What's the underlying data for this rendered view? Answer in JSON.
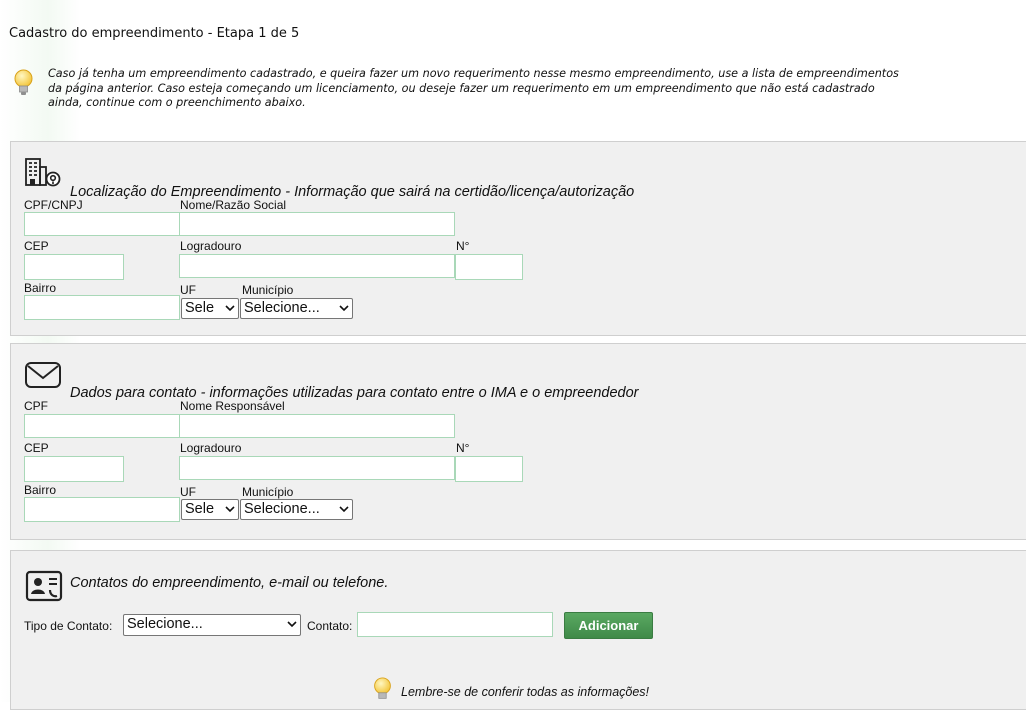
{
  "page_title": "Cadastro do empreendimento - Etapa 1 de 5",
  "notice": {
    "lines": [
      "Caso já tenha um empreendimento cadastrado, e queira fazer um novo requerimento nesse mesmo empreendimento, use a lista de empreendimentos",
      "da página anterior. Caso esteja começando um licenciamento, ou deseje fazer um requerimento em um empreendimento que não está cadastrado",
      "ainda, continue com o preenchimento abaixo."
    ]
  },
  "location": {
    "title": "Localização do Empreendimento - Informação que sairá na certidão/licença/autorização",
    "cpf_cnpj_label": "CPF/CNPJ",
    "name_label": "Nome/Razão Social",
    "cep_label": "CEP",
    "street_label": "Logradouro",
    "number_label": "N°",
    "district_label": "Bairro",
    "uf_label": "UF",
    "city_label": "Município",
    "uf_value": "Sele",
    "city_value": "Selecione..."
  },
  "contact": {
    "title": "Dados para contato - informações utilizadas para contato entre o IMA e o empreendedor",
    "cpf_label": "CPF",
    "name_label": "Nome Responsável",
    "cep_label": "CEP",
    "street_label": "Logradouro",
    "number_label": "N°",
    "district_label": "Bairro",
    "uf_label": "UF",
    "city_label": "Município",
    "uf_value": "Sele",
    "city_value": "Selecione..."
  },
  "contacts": {
    "title": "Contatos do empreendimento, e-mail ou telefone.",
    "type_label": "Tipo de Contato:",
    "type_value": "Selecione...",
    "contact_label": "Contato:",
    "add_button": "Adicionar"
  },
  "reminder": "Lembre-se de conferir todas as informações!",
  "icons": {
    "notice": "lightbulb-icon",
    "location": "building-location-icon",
    "contact": "envelope-icon",
    "contacts": "contact-card-icon",
    "reminder": "lightbulb-icon"
  },
  "colors": {
    "panel_bg": "#f0f0f0",
    "field_border": "#a9d8b8",
    "button_green": "#4a9a52"
  }
}
